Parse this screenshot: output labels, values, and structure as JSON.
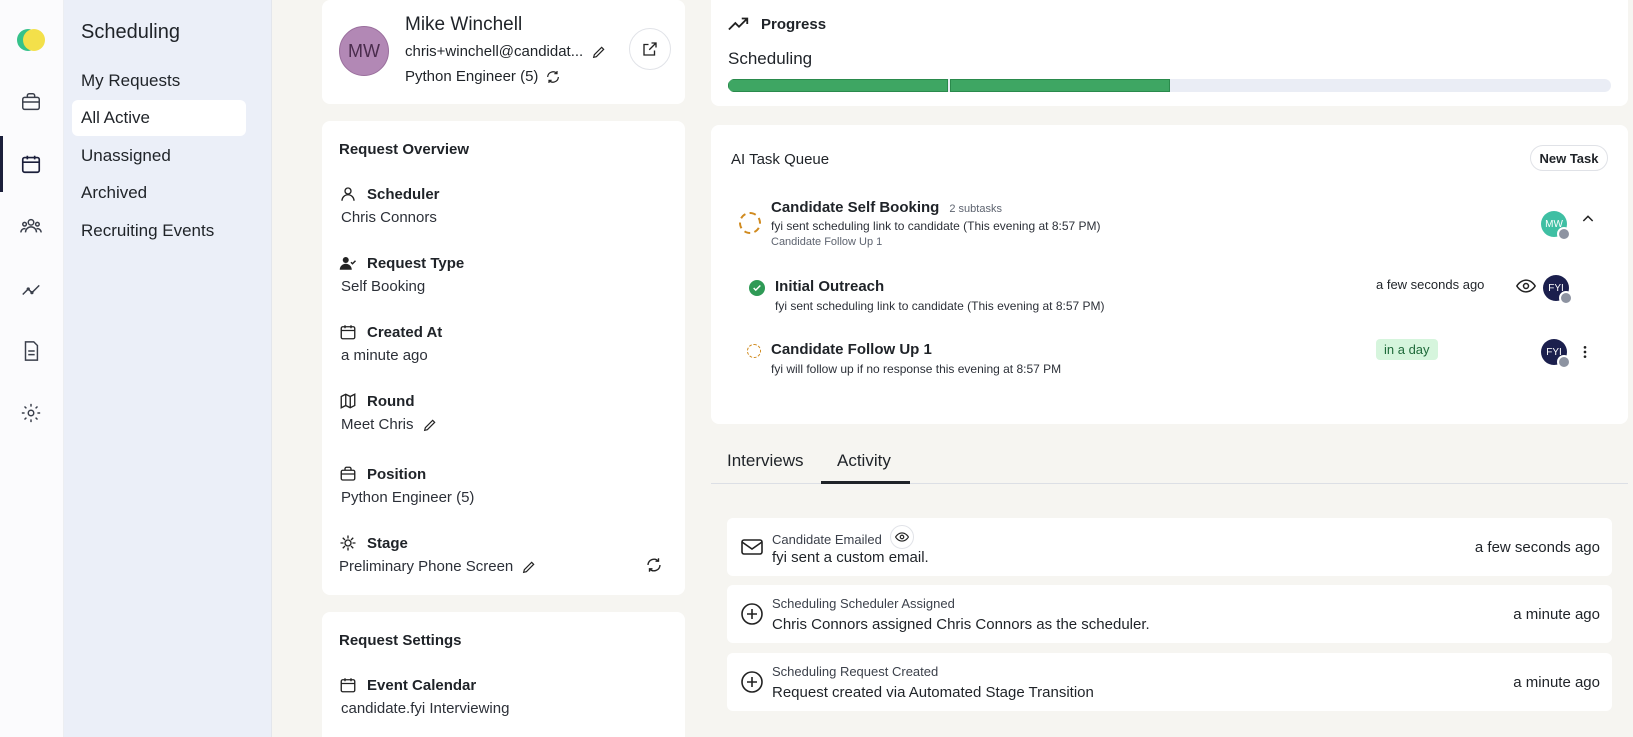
{
  "app": {
    "section_title": "Scheduling"
  },
  "rail": {
    "icons": [
      "logo-icon",
      "briefcase-icon",
      "calendar-icon",
      "people-icon",
      "analytics-icon",
      "document-icon",
      "gear-icon"
    ]
  },
  "nav": {
    "items": [
      {
        "label": "My Requests"
      },
      {
        "label": "All Active"
      },
      {
        "label": "Unassigned"
      },
      {
        "label": "Archived"
      },
      {
        "label": "Recruiting Events"
      }
    ]
  },
  "candidate": {
    "initials": "MW",
    "name": "Mike Winchell",
    "email": "chris+winchell@candidat...",
    "position": "Python Engineer (5)"
  },
  "overview": {
    "title": "Request Overview",
    "fields": [
      {
        "label": "Scheduler",
        "value": "Chris Connors",
        "icon": "person-icon"
      },
      {
        "label": "Request Type",
        "value": "Self Booking",
        "icon": "user-check-icon"
      },
      {
        "label": "Created At",
        "value": "a minute ago",
        "icon": "calendar-icon"
      },
      {
        "label": "Round",
        "value": "Meet Chris",
        "icon": "map-icon"
      },
      {
        "label": "Position",
        "value": "Python Engineer (5)",
        "icon": "briefcase-icon"
      },
      {
        "label": "Stage",
        "value": "Preliminary Phone Screen",
        "icon": "stage-gear-icon"
      }
    ]
  },
  "settings": {
    "title": "Request Settings",
    "fields": [
      {
        "label": "Event Calendar",
        "value": "candidate.fyi Interviewing",
        "icon": "calendar-icon"
      }
    ]
  },
  "progress": {
    "title": "Progress",
    "stage": "Scheduling",
    "completed_segments": 2,
    "total_segments": 4,
    "accent": "#3ea663"
  },
  "queue": {
    "title": "AI Task Queue",
    "new_task_label": "New Task",
    "main_task": {
      "title": "Candidate Self Booking",
      "subtasks": "2 subtasks",
      "description": "fyi sent scheduling link to candidate (This evening at 8:57 PM)",
      "next": "Candidate Follow Up 1",
      "avatar": "MW"
    },
    "subtasks": [
      {
        "title": "Initial Outreach",
        "description": "fyi sent scheduling link to candidate (This evening at 8:57 PM)",
        "time": "a few seconds ago",
        "avatar": "FYI",
        "status": "done"
      },
      {
        "title": "Candidate Follow Up 1",
        "description": "fyi will follow up if no response this evening at 8:57 PM",
        "time": "in a day",
        "avatar": "FYI",
        "status": "pending"
      }
    ]
  },
  "tabs": [
    {
      "label": "Interviews"
    },
    {
      "label": "Activity"
    }
  ],
  "activity": [
    {
      "type": "Candidate Emailed",
      "text": "fyi sent a custom email.",
      "time": "a few seconds ago",
      "icon": "mail-icon"
    },
    {
      "type": "Scheduling Scheduler Assigned",
      "text": "Chris Connors assigned Chris Connors as the scheduler.",
      "time": "a minute ago",
      "icon": "plus-circle-icon"
    },
    {
      "type": "Scheduling Request Created",
      "text": "Request created via Automated Stage Transition",
      "time": "a minute ago",
      "icon": "plus-circle-icon"
    }
  ]
}
